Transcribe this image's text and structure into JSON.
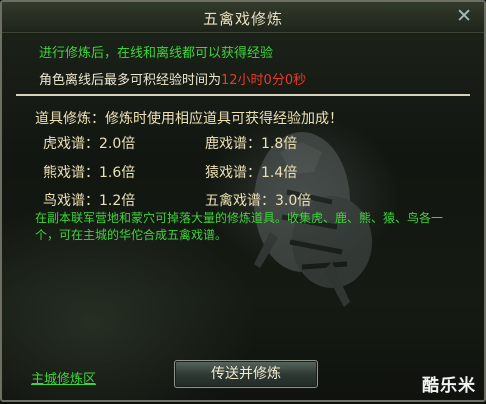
{
  "window": {
    "title": "五禽戏修炼",
    "close_glyph": "✕"
  },
  "intro": "进行修炼后，在线和离线都可以获得经验",
  "offline_limit": {
    "label": "角色离线后最多可积经验时间为",
    "value": "12小时0分0秒",
    "value_color": "#e83a2a"
  },
  "items": {
    "heading": "道具修炼：修炼时使用相应道具可获得经验加成！",
    "multipliers": [
      {
        "text": "虎戏谱：2.0倍"
      },
      {
        "text": "鹿戏谱：1.8倍"
      },
      {
        "text": "熊戏谱：1.6倍"
      },
      {
        "text": "猿戏谱：1.4倍"
      },
      {
        "text": "鸟戏谱：1.2倍"
      },
      {
        "text": "五禽戏谱：3.0倍"
      }
    ],
    "note": "在副本联军营地和蒙穴可掉落大量的修炼道具。收集虎、鹿、熊、猿、鸟各一个，可在主城的华佗合成五禽戏谱。"
  },
  "footer": {
    "zone_link": "主城修炼区",
    "teleport_button": "传送并修炼"
  },
  "watermark": "酷乐米",
  "colors": {
    "accent_green": "#3fd43a",
    "text_cream": "#ece0b5",
    "panel_bg": "#151b13"
  }
}
